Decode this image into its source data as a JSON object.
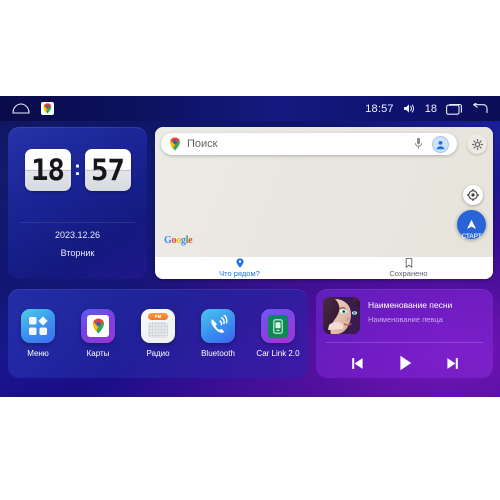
{
  "statusbar": {
    "home_icon": "home-icon",
    "maps_icon": "google-maps-icon",
    "time": "18:57",
    "volume_icon": "volume-icon",
    "volume_level": "18",
    "recents_icon": "recent-apps-icon",
    "back_icon": "back-icon"
  },
  "clock": {
    "hours": "18",
    "minutes": "57",
    "separator": ":",
    "date": "2023.12.26",
    "weekday": "Вторник"
  },
  "maps": {
    "search_placeholder": "Поиск",
    "pin_icon": "map-pin-icon",
    "mic_icon": "microphone-icon",
    "avatar_icon": "account-avatar-icon",
    "gear_icon": "gear-icon",
    "locate_icon": "compass-icon",
    "start_label": "СТАРТ",
    "attribution": "Google",
    "attribution_letters": [
      "G",
      "o",
      "o",
      "g",
      "l",
      "e"
    ],
    "tabs": [
      {
        "label": "Что рядом?",
        "icon": "location-pin-icon",
        "active": true
      },
      {
        "label": "Сохранено",
        "icon": "bookmark-icon",
        "active": false
      }
    ]
  },
  "apps": [
    {
      "label": "Меню",
      "icon": "grid-menu-icon"
    },
    {
      "label": "Карты",
      "icon": "google-maps-icon"
    },
    {
      "label": "Радио",
      "icon": "fm-radio-icon",
      "badge": "FM"
    },
    {
      "label": "Bluetooth",
      "icon": "bluetooth-phone-icon"
    },
    {
      "label": "Car Link 2.0",
      "icon": "car-link-icon"
    }
  ],
  "music": {
    "album_art": "album-art-portrait",
    "title": "Наименование песни",
    "artist": "Наименование певца",
    "prev_icon": "previous-track-icon",
    "play_icon": "play-icon",
    "next_icon": "next-track-icon"
  },
  "colors": {
    "bg_blue": "#131a86",
    "bg_purple": "#7c16be",
    "accent_blue": "#1a73e8",
    "start_blue": "#2864d8",
    "map_bg": "#e8e5de"
  }
}
